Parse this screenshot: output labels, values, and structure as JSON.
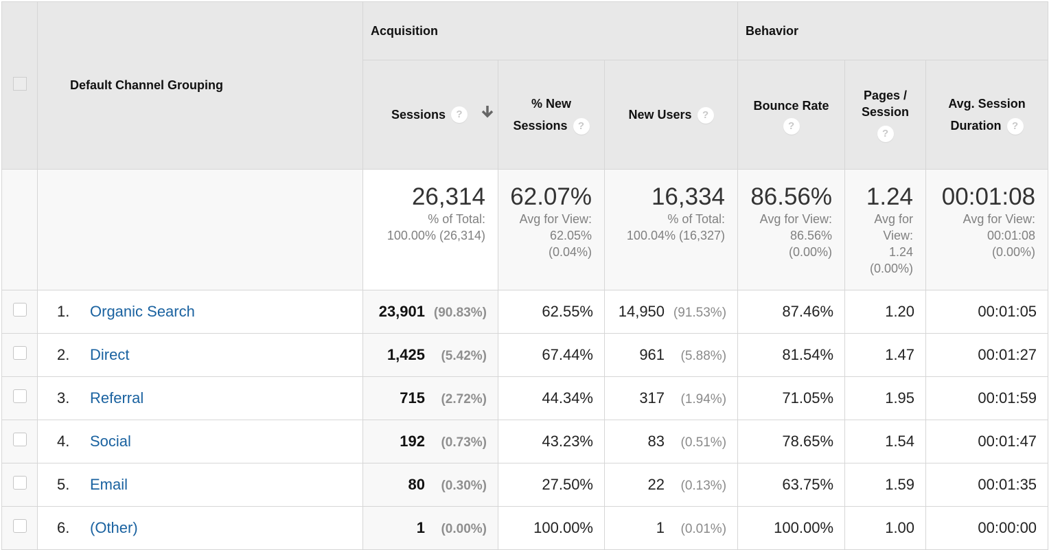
{
  "header": {
    "dimension": "Default Channel Grouping",
    "groups": {
      "acquisition": "Acquisition",
      "behavior": "Behavior"
    },
    "columns": {
      "sessions": "Sessions",
      "pct_new_sessions_line1": "% New",
      "pct_new_sessions_line2": "Sessions",
      "new_users": "New Users",
      "bounce_rate": "Bounce Rate",
      "pages_session_line1": "Pages /",
      "pages_session_line2": "Session",
      "avg_duration_line1": "Avg. Session",
      "avg_duration_line2": "Duration"
    },
    "help_glyph": "?",
    "sort_icon": "arrow-down",
    "sort_column": "Sessions"
  },
  "totals": {
    "sessions": {
      "value": "26,314",
      "l1": "% of Total:",
      "l2": "100.00% (26,314)"
    },
    "pct_new_sessions": {
      "value": "62.07%",
      "l1": "Avg for View:",
      "l2": "62.05%",
      "l3": "(0.04%)"
    },
    "new_users": {
      "value": "16,334",
      "l1": "% of Total:",
      "l2": "100.04% (16,327)"
    },
    "bounce_rate": {
      "value": "86.56%",
      "l1": "Avg for View:",
      "l2": "86.56%",
      "l3": "(0.00%)"
    },
    "pages_session": {
      "value": "1.24",
      "l1": "Avg for",
      "l2": "View:",
      "l3": "1.24",
      "l4": "(0.00%)"
    },
    "avg_duration": {
      "value": "00:01:08",
      "l1": "Avg for View:",
      "l2": "00:01:08",
      "l3": "(0.00%)"
    }
  },
  "rows": [
    {
      "index": "1.",
      "channel": "Organic Search",
      "sessions": "23,901",
      "sessions_pct": "(90.83%)",
      "pct_new": "62.55%",
      "new_users": "14,950",
      "new_users_pct": "(91.53%)",
      "bounce": "87.46%",
      "pages": "1.20",
      "duration": "00:01:05"
    },
    {
      "index": "2.",
      "channel": "Direct",
      "sessions": "1,425",
      "sessions_pct": "(5.42%)",
      "pct_new": "67.44%",
      "new_users": "961",
      "new_users_pct": "(5.88%)",
      "bounce": "81.54%",
      "pages": "1.47",
      "duration": "00:01:27"
    },
    {
      "index": "3.",
      "channel": "Referral",
      "sessions": "715",
      "sessions_pct": "(2.72%)",
      "pct_new": "44.34%",
      "new_users": "317",
      "new_users_pct": "(1.94%)",
      "bounce": "71.05%",
      "pages": "1.95",
      "duration": "00:01:59"
    },
    {
      "index": "4.",
      "channel": "Social",
      "sessions": "192",
      "sessions_pct": "(0.73%)",
      "pct_new": "43.23%",
      "new_users": "83",
      "new_users_pct": "(0.51%)",
      "bounce": "78.65%",
      "pages": "1.54",
      "duration": "00:01:47"
    },
    {
      "index": "5.",
      "channel": "Email",
      "sessions": "80",
      "sessions_pct": "(0.30%)",
      "pct_new": "27.50%",
      "new_users": "22",
      "new_users_pct": "(0.13%)",
      "bounce": "63.75%",
      "pages": "1.59",
      "duration": "00:01:35"
    },
    {
      "index": "6.",
      "channel": "(Other)",
      "sessions": "1",
      "sessions_pct": "(0.00%)",
      "pct_new": "100.00%",
      "new_users": "1",
      "new_users_pct": "(0.01%)",
      "bounce": "100.00%",
      "pages": "1.00",
      "duration": "00:00:00"
    }
  ],
  "colors": {
    "link": "#1a62a0",
    "header_bg": "#e8e8e8",
    "border": "#d6d6d6"
  }
}
